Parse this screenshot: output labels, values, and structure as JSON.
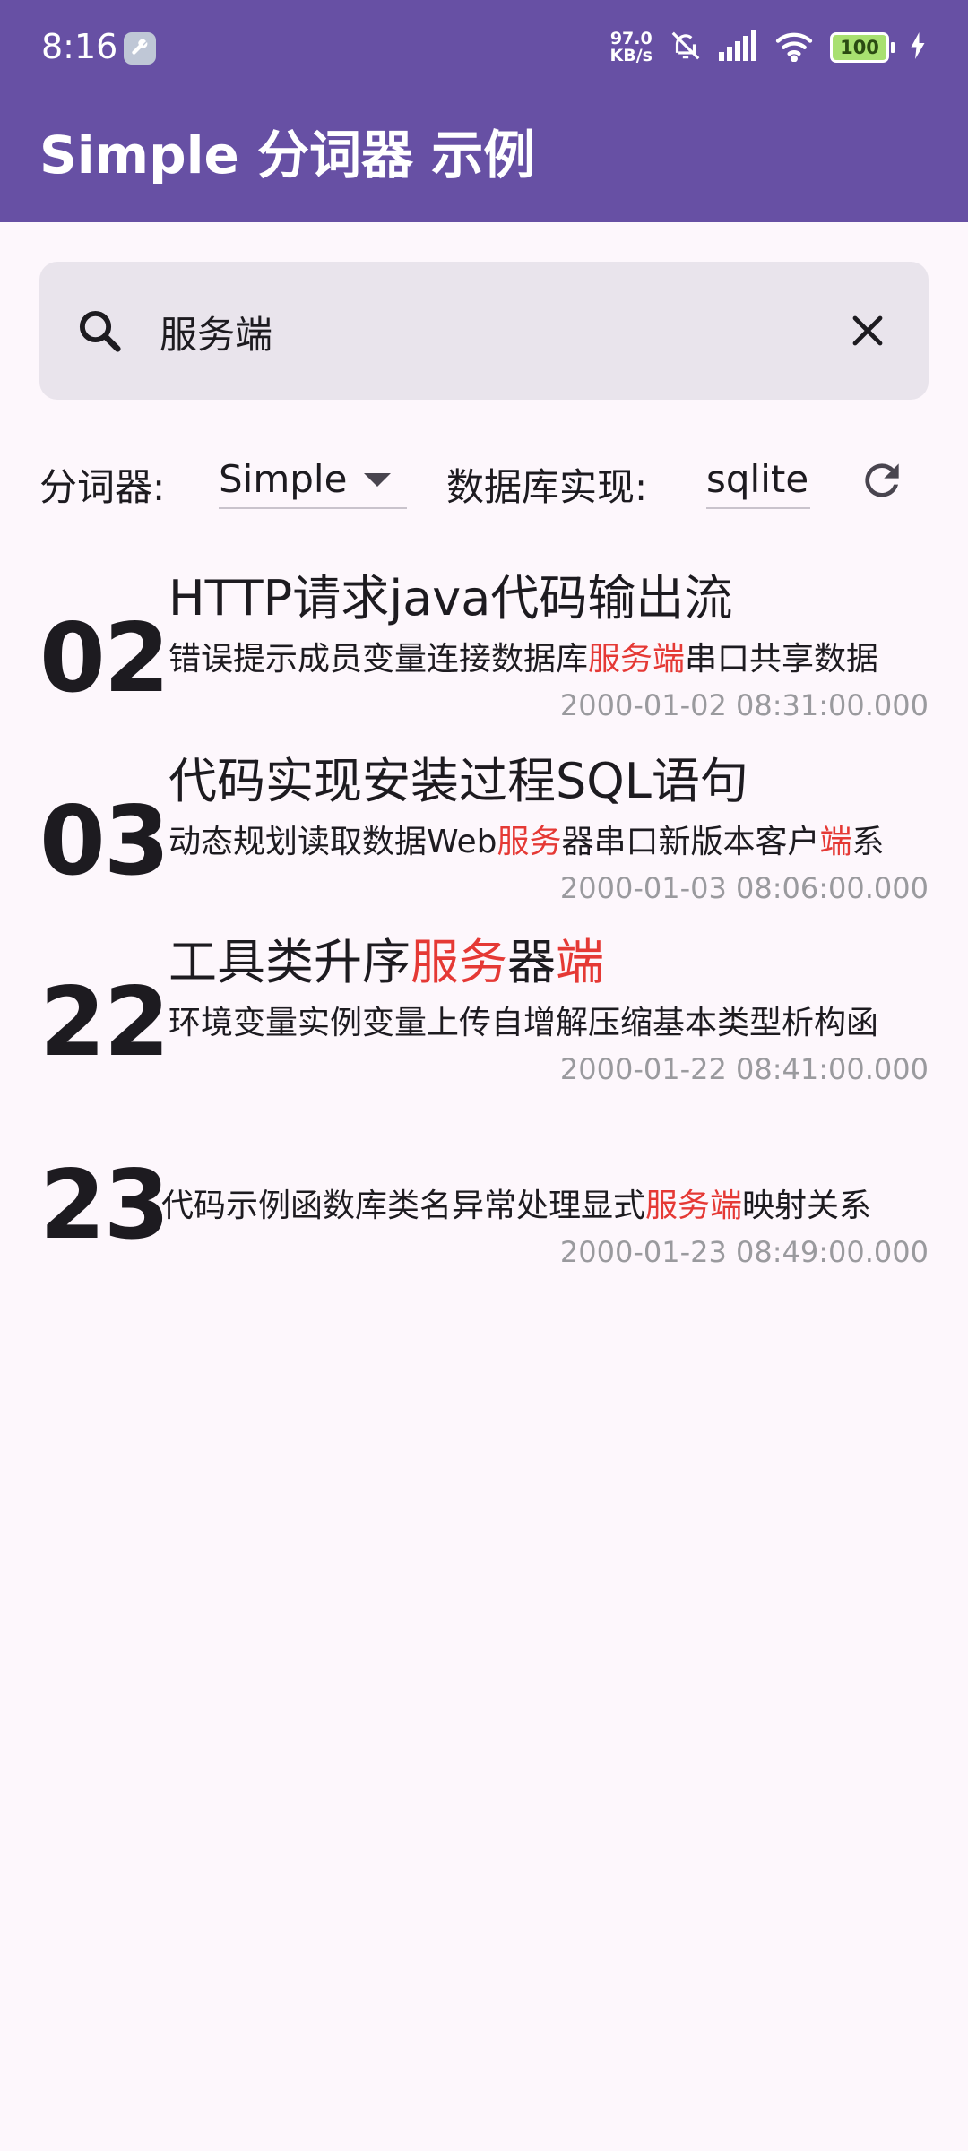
{
  "status_bar": {
    "time": "8:16",
    "net_speed_value": "97.0",
    "net_speed_unit": "KB/s",
    "battery": "100"
  },
  "app_bar": {
    "title": "Simple 分词器 示例"
  },
  "search": {
    "value": "服务端"
  },
  "options": {
    "tokenizer_label": "分词器:",
    "tokenizer_value": "Simple",
    "db_label": "数据库实现:",
    "db_value": "sqlite"
  },
  "results": [
    {
      "num": "02",
      "title": [
        {
          "t": "HTTP请求java代码输出流",
          "h": false
        }
      ],
      "content": [
        {
          "t": "错误提示成员变量连接数据库",
          "h": false
        },
        {
          "t": "服务端",
          "h": true
        },
        {
          "t": "串口共享数据",
          "h": false
        }
      ],
      "date": "2000-01-02 08:31:00.000"
    },
    {
      "num": "03",
      "title": [
        {
          "t": "代码实现安装过程SQL语句",
          "h": false
        }
      ],
      "content": [
        {
          "t": "动态规划读取数据Web",
          "h": false
        },
        {
          "t": "服务",
          "h": true
        },
        {
          "t": "器串口新版本客户",
          "h": false
        },
        {
          "t": "端",
          "h": true
        },
        {
          "t": "系",
          "h": false
        }
      ],
      "date": "2000-01-03 08:06:00.000"
    },
    {
      "num": "22",
      "title": [
        {
          "t": "工具类升序",
          "h": false
        },
        {
          "t": "服务",
          "h": true
        },
        {
          "t": "器",
          "h": false
        },
        {
          "t": "端",
          "h": true
        }
      ],
      "content": [
        {
          "t": "环境变量实例变量上传自增解压缩基本类型析构函",
          "h": false
        }
      ],
      "date": "2000-01-22 08:41:00.000"
    },
    {
      "num": "23",
      "title": [],
      "content": [
        {
          "t": "代码示例函数库类名异常处理显式",
          "h": false
        },
        {
          "t": "服务端",
          "h": true
        },
        {
          "t": "映射关系",
          "h": false
        }
      ],
      "date": "2000-01-23 08:49:00.000"
    }
  ]
}
